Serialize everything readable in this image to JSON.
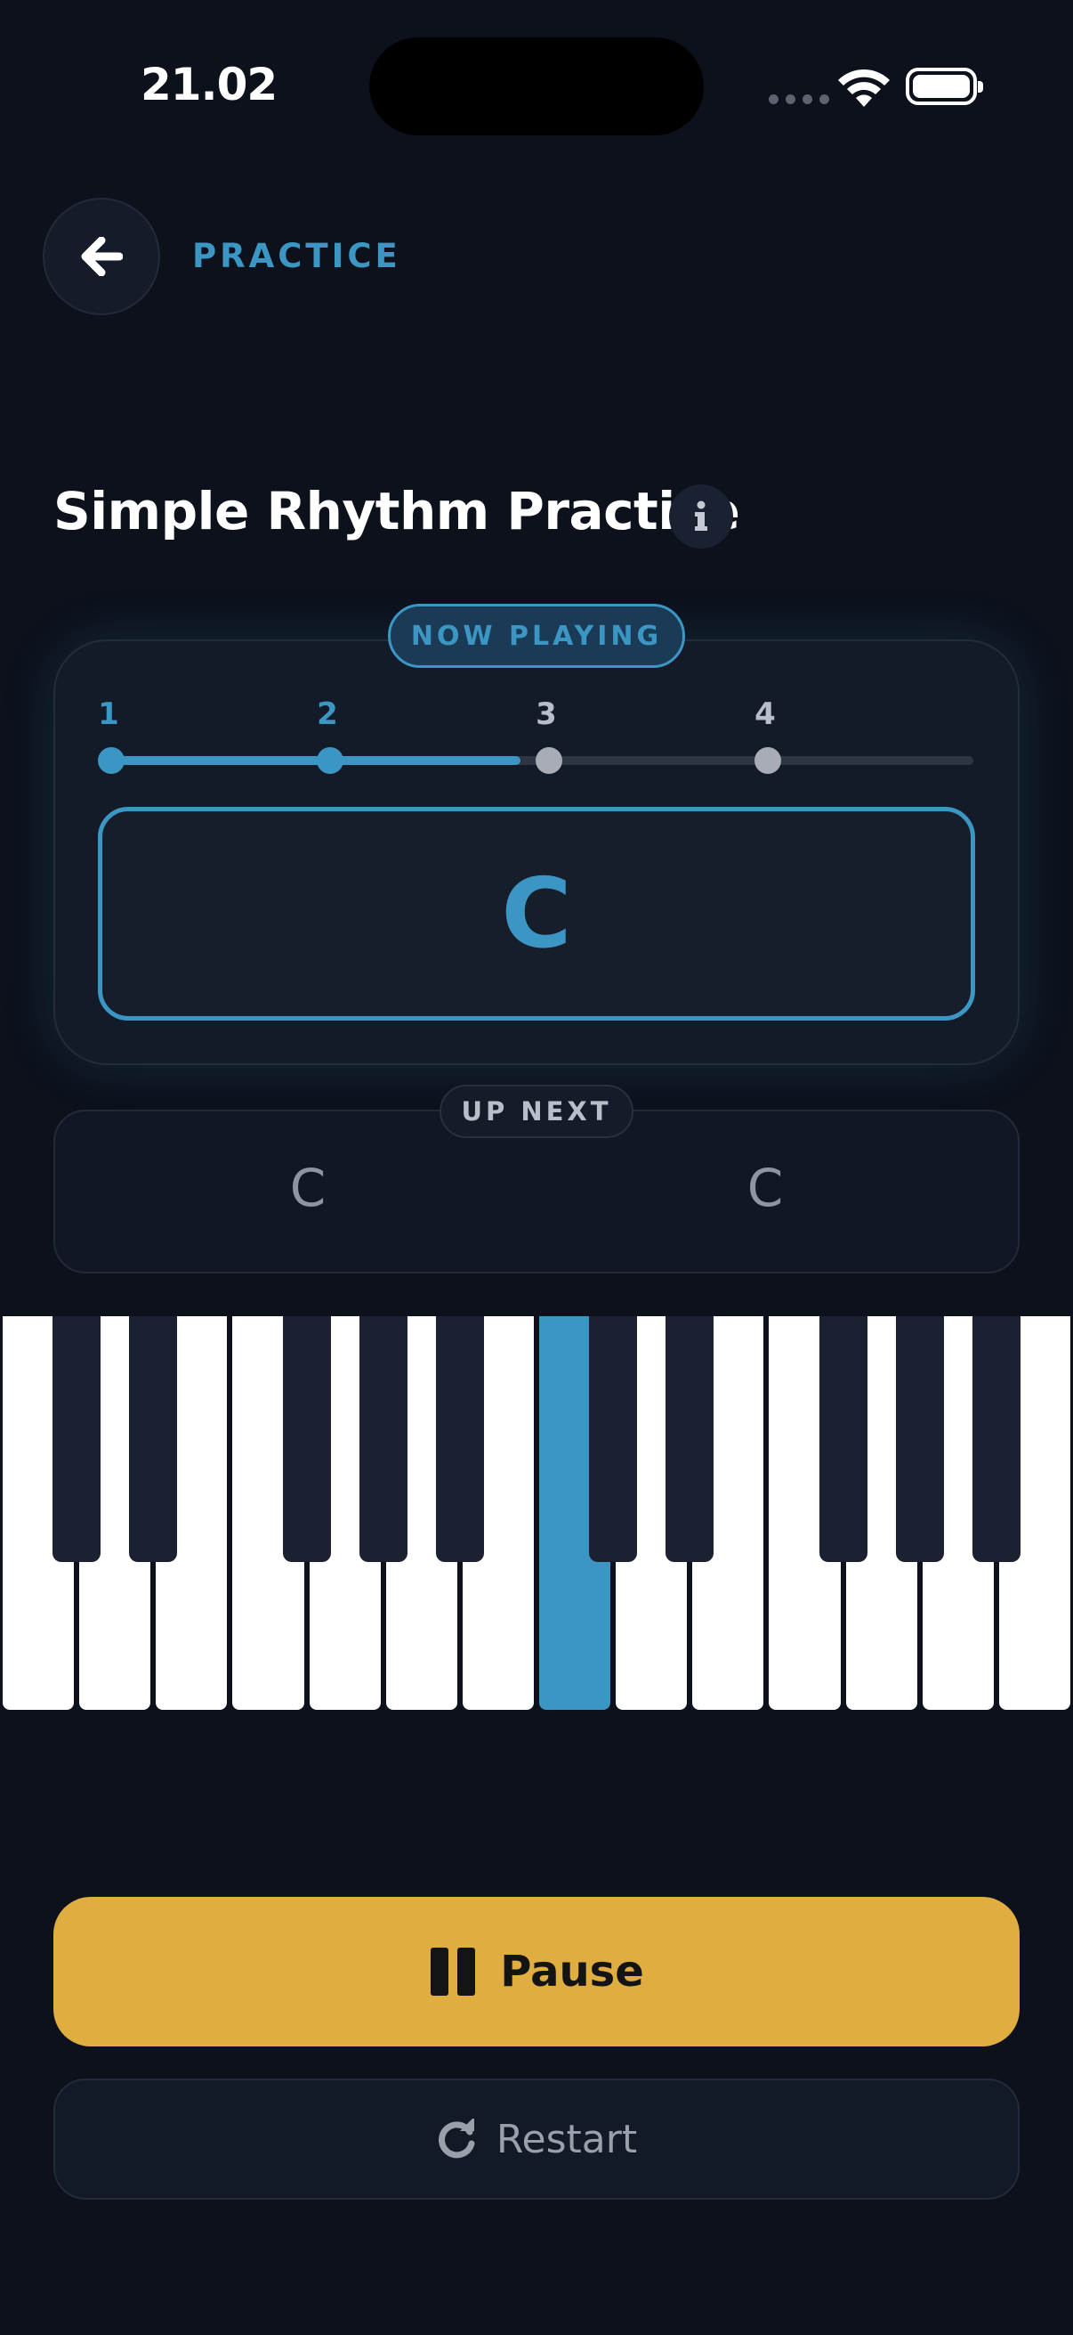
{
  "status_bar": {
    "time": "21.02"
  },
  "header": {
    "label": "PRACTICE"
  },
  "title": "Simple Rhythm Practice",
  "now_playing": {
    "badge": "NOW PLAYING",
    "beats": [
      "1",
      "2",
      "3",
      "4"
    ],
    "active_beat_count": 2,
    "progress": 0.475,
    "current_chord": "C"
  },
  "up_next": {
    "badge": "UP NEXT",
    "chords": [
      "C",
      "C"
    ]
  },
  "piano": {
    "active_white_key_index": 7
  },
  "actions": {
    "pause_label": "Pause",
    "restart_label": "Restart"
  },
  "colors": {
    "accent": "#3b96c4",
    "pause_button": "#e0ad40",
    "background": "#0c111c"
  }
}
